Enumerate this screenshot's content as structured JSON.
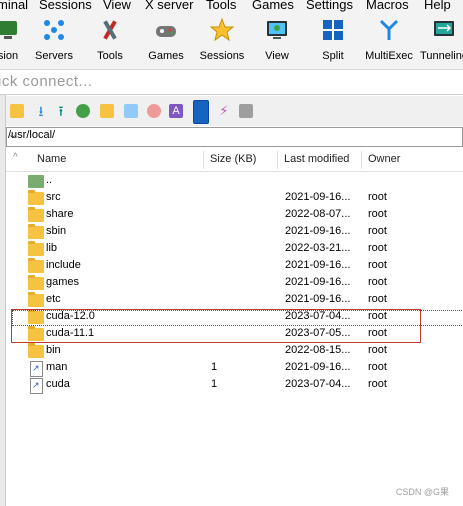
{
  "menu": [
    "minal",
    "Sessions",
    "View",
    "X server",
    "Tools",
    "Games",
    "Settings",
    "Macros",
    "Help"
  ],
  "toolbar": [
    {
      "label": "sion",
      "icon": "session-icon"
    },
    {
      "label": "Servers",
      "icon": "servers-icon"
    },
    {
      "label": "Tools",
      "icon": "tools-icon"
    },
    {
      "label": "Games",
      "icon": "games-icon"
    },
    {
      "label": "Sessions",
      "icon": "sessions-star-icon"
    },
    {
      "label": "View",
      "icon": "view-icon"
    },
    {
      "label": "Split",
      "icon": "split-icon"
    },
    {
      "label": "MultiExec",
      "icon": "multiexec-icon"
    },
    {
      "label": "Tunneling",
      "icon": "tunneling-icon"
    }
  ],
  "quick_connect": "ick connect...",
  "path": "/usr/local/",
  "columns": {
    "name": "Name",
    "size": "Size (KB)",
    "modified": "Last modified",
    "owner": "Owner"
  },
  "files": [
    {
      "name": "..",
      "size": "",
      "modified": "",
      "owner": "",
      "kind": "up"
    },
    {
      "name": "src",
      "size": "",
      "modified": "2021-09-16...",
      "owner": "root",
      "kind": "folder"
    },
    {
      "name": "share",
      "size": "",
      "modified": "2022-08-07...",
      "owner": "root",
      "kind": "folder"
    },
    {
      "name": "sbin",
      "size": "",
      "modified": "2021-09-16...",
      "owner": "root",
      "kind": "folder"
    },
    {
      "name": "lib",
      "size": "",
      "modified": "2022-03-21...",
      "owner": "root",
      "kind": "folder"
    },
    {
      "name": "include",
      "size": "",
      "modified": "2021-09-16...",
      "owner": "root",
      "kind": "folder"
    },
    {
      "name": "games",
      "size": "",
      "modified": "2021-09-16...",
      "owner": "root",
      "kind": "folder"
    },
    {
      "name": "etc",
      "size": "",
      "modified": "2021-09-16...",
      "owner": "root",
      "kind": "folder"
    },
    {
      "name": "cuda-12.0",
      "size": "",
      "modified": "2023-07-04...",
      "owner": "root",
      "kind": "folder"
    },
    {
      "name": "cuda-11.1",
      "size": "",
      "modified": "2023-07-05...",
      "owner": "root",
      "kind": "folder"
    },
    {
      "name": "bin",
      "size": "",
      "modified": "2022-08-15...",
      "owner": "root",
      "kind": "folder"
    },
    {
      "name": "man",
      "size": "1",
      "modified": "2021-09-16...",
      "owner": "root",
      "kind": "link"
    },
    {
      "name": "cuda",
      "size": "1",
      "modified": "2023-07-04...",
      "owner": "root",
      "kind": "link"
    }
  ],
  "watermark": "CSDN @G果"
}
